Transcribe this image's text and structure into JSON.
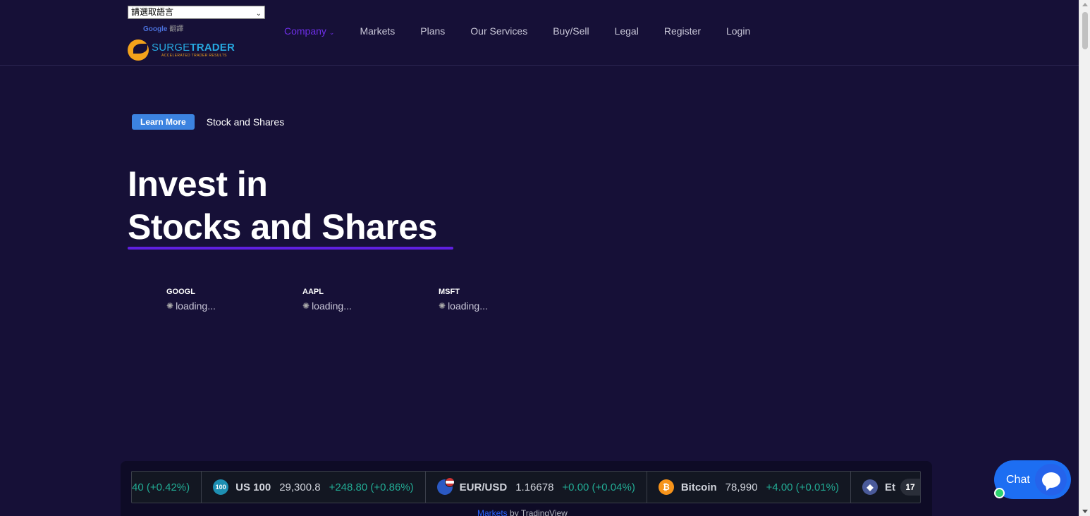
{
  "translate": {
    "select_value": "請選取語言",
    "google_label": "Google",
    "translate_label": "翻譯"
  },
  "logo": {
    "brand_surge": "SURGE",
    "brand_trader": "TRADER",
    "tagline": "ACCELERATED TRADER RESULTS"
  },
  "nav": {
    "items": [
      {
        "label": "Company",
        "active": true
      },
      {
        "label": "Markets"
      },
      {
        "label": "Plans"
      },
      {
        "label": "Our Services"
      },
      {
        "label": "Buy/Sell"
      },
      {
        "label": "Legal"
      },
      {
        "label": "Register"
      },
      {
        "label": "Login"
      }
    ]
  },
  "hero": {
    "button": "Learn More",
    "badge_text": "Stock and Shares",
    "title_line1": "Invest in",
    "title_line2": "Stocks and Shares"
  },
  "tickers": [
    {
      "symbol": "GOOGL",
      "status": "loading..."
    },
    {
      "symbol": "AAPL",
      "status": "loading..."
    },
    {
      "symbol": "MSFT",
      "status": "loading..."
    }
  ],
  "tape": {
    "partial_change": "40 (+0.42%)",
    "items": [
      {
        "icon": "100",
        "name": "US 100",
        "price": "29,300.8",
        "change": "+248.80 (+0.86%)"
      },
      {
        "icon": "",
        "name": "EUR/USD",
        "price": "1.16678",
        "change": "+0.00 (+0.04%)"
      },
      {
        "icon": "₿",
        "name": "Bitcoin",
        "price": "78,990",
        "change": "+4.00 (+0.01%)"
      },
      {
        "icon": "◆",
        "name": "Et"
      }
    ],
    "attribution_link": "Markets",
    "attribution_rest": " by TradingView",
    "tv_logo": "17"
  },
  "chat": {
    "label": "Chat"
  },
  "colors": {
    "background": "#161037",
    "accent_purple": "#5f1fe0",
    "button_blue": "#3c83e0",
    "positive_green": "#22ab94",
    "chat_blue": "#1d6ef2"
  }
}
